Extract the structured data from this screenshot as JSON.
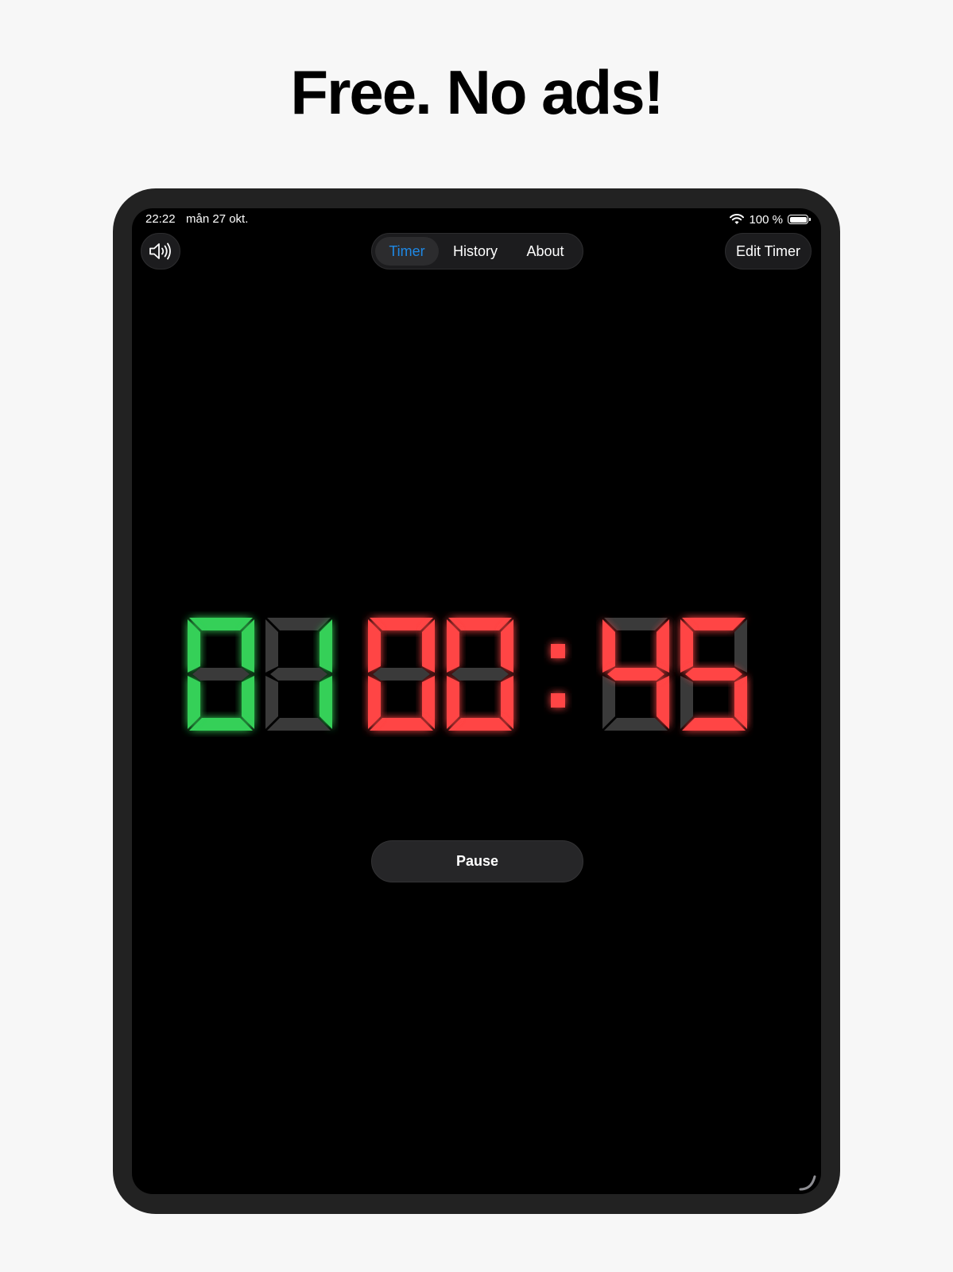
{
  "headline": "Free. No ads!",
  "status_bar": {
    "time": "22:22",
    "date": "mån 27 okt.",
    "battery": "100 %"
  },
  "toolbar": {
    "sound_icon": "speaker-wave-icon",
    "tabs": [
      {
        "label": "Timer",
        "active": true
      },
      {
        "label": "History",
        "active": false
      },
      {
        "label": "About",
        "active": false
      }
    ],
    "edit_label": "Edit Timer"
  },
  "timer": {
    "digits": [
      "0",
      "1",
      "0",
      "0",
      "4",
      "5"
    ],
    "separator": ":",
    "colors": {
      "green": "#34d058",
      "red": "#ff4545",
      "inactive": "#3a3a3a"
    }
  },
  "pause_label": "Pause"
}
